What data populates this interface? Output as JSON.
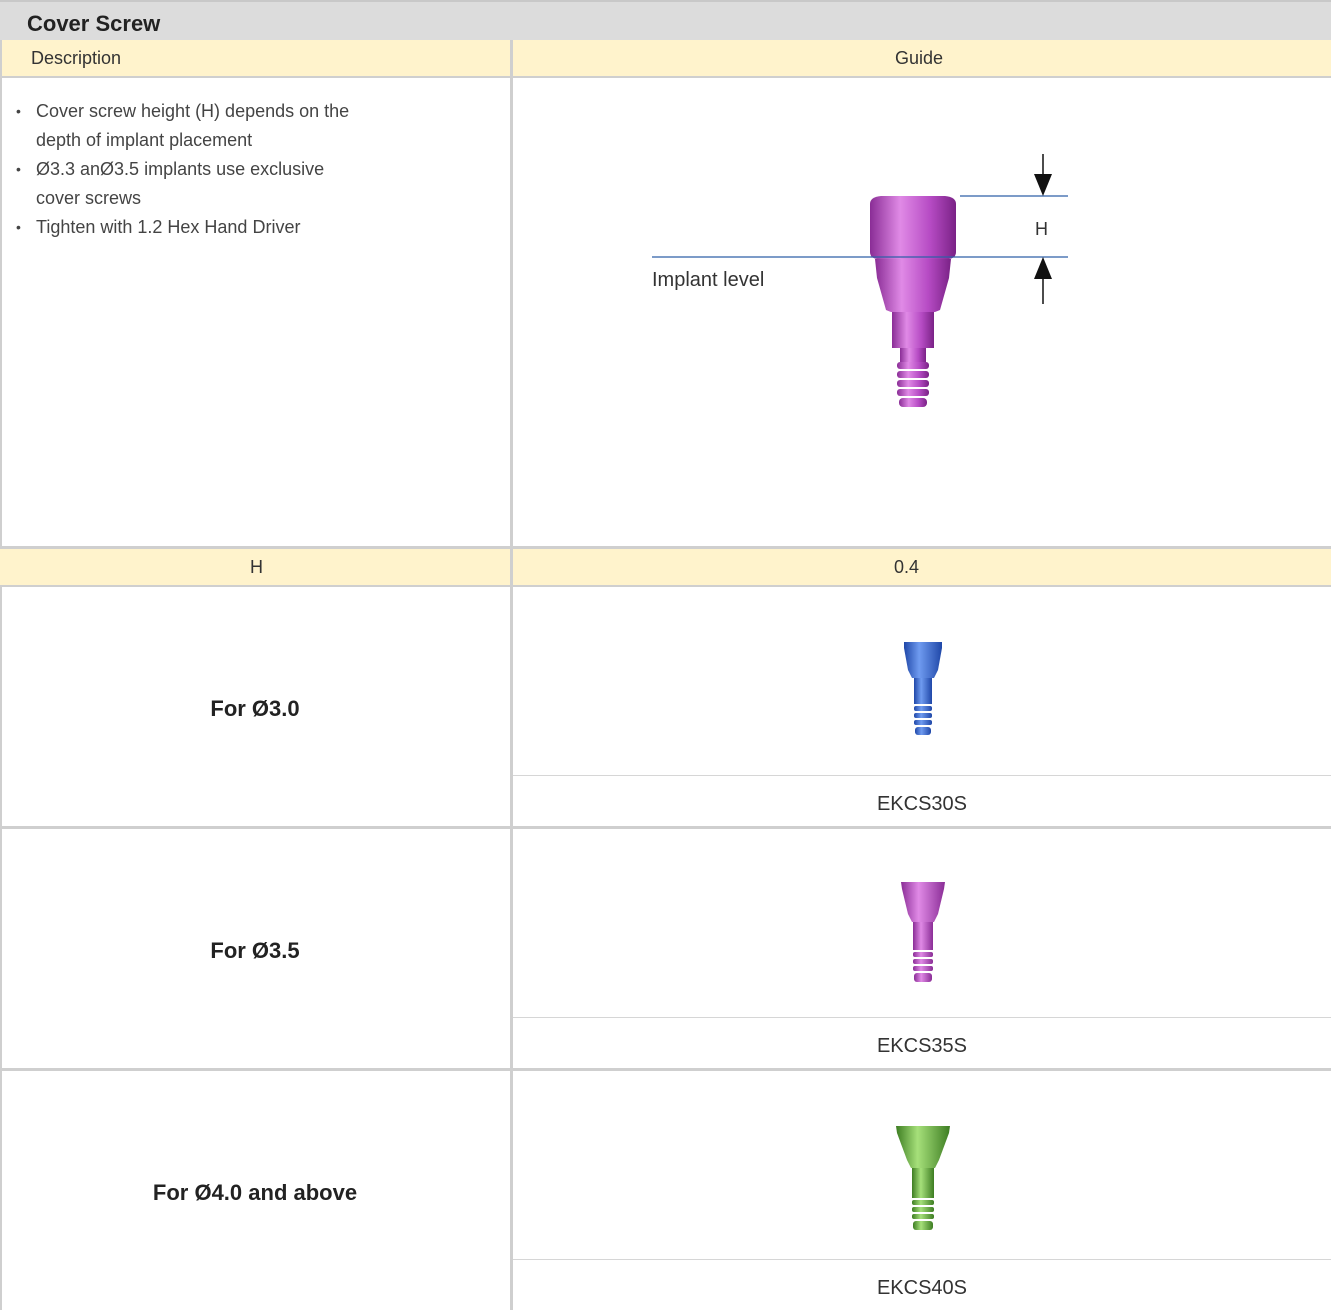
{
  "title": "Cover Screw",
  "headers": {
    "description": "Description",
    "guide": "Guide"
  },
  "bullets": [
    "Cover screw height (H) depends on the depth of implant placement",
    "Ø3.3 anØ3.5 implants use exclusive cover screws",
    "Tighten with 1.2 Hex Hand Driver"
  ],
  "diagram": {
    "h_label": "H",
    "implant_level": "Implant level"
  },
  "h_row": {
    "label": "H",
    "value": "0.4"
  },
  "products": [
    {
      "label": "For Ø3.0",
      "code": "EKCS30S",
      "color": "#3a6fd8"
    },
    {
      "label": "For Ø3.5",
      "code": "EKCS35S",
      "color": "#b64bc4"
    },
    {
      "label": "For Ø4.0 and above",
      "code": "EKCS40S",
      "color": "#5cab3a"
    }
  ],
  "colors": {
    "title_bg": "#dcdcdc",
    "header_bg": "#fff3cc",
    "level_line": "#2f5fa8",
    "screw_main": "#b64bc4"
  }
}
